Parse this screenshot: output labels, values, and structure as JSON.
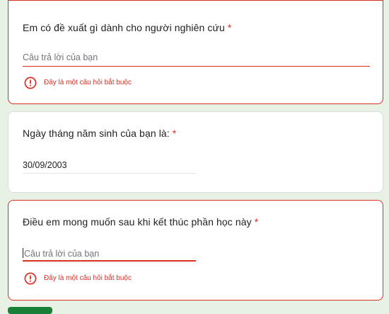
{
  "questions": [
    {
      "title": "Em có đề xuất gì dành cho người nghiên cứu",
      "required_mark": "*",
      "placeholder": "Câu trả lời của bạn",
      "error": "Đây là một câu hỏi bắt buộc"
    },
    {
      "title": "Ngày tháng năm sinh của bạn là:",
      "required_mark": "*",
      "value": "30/09/2003"
    },
    {
      "title": "Điều em mong muốn sau khi kết thúc phần học này",
      "required_mark": "*",
      "placeholder": "Câu trả lời của bạn",
      "error": "Đây là một câu hỏi bắt buộc"
    }
  ],
  "colors": {
    "error": "#d93025",
    "page_background": "#e8f2e4",
    "card_background": "#ffffff",
    "text": "#202124",
    "placeholder": "#70757a",
    "next_button": "#188038"
  },
  "icons": {
    "error_icon": "error-circle-exclamation"
  }
}
